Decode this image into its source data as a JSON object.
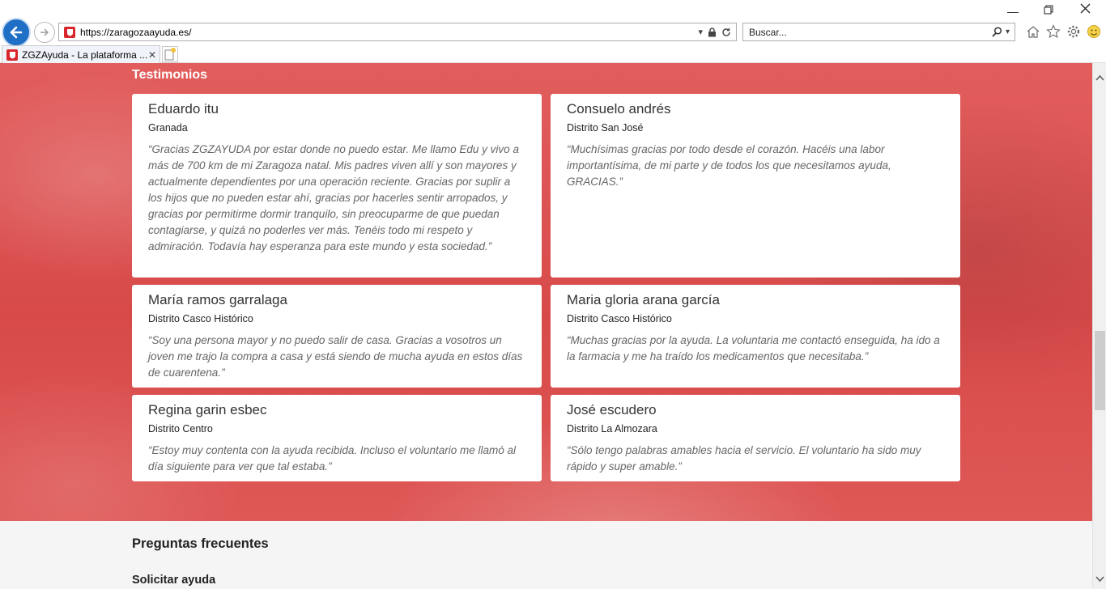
{
  "browser": {
    "url": "https://zaragozaayuda.es/",
    "search_placeholder": "Buscar...",
    "tab_title": "ZGZAyuda - La plataforma ...",
    "tab_close": "✕"
  },
  "testimonials": {
    "title": "Testimonios",
    "items": [
      {
        "name": "Eduardo itu",
        "place": "Granada",
        "quote": "“Gracias ZGZAYUDA por estar donde no puedo estar. Me llamo Edu y vivo a más de 700 km de mi Zaragoza natal. Mis padres viven allí y son mayores y actualmente dependientes por una operación reciente. Gracias por suplir a los hijos que no pueden estar ahí, gracias por hacerles sentir arropados, y gracias por permitirme dormir tranquilo, sin preocuparme de que puedan contagiarse, y quizá no poderles ver más. Tenéis todo mi respeto y admiración. Todavía hay esperanza para este mundo y esta sociedad.”"
      },
      {
        "name": "Consuelo andrés",
        "place": "Distrito San José",
        "quote": "“Muchísimas gracias por todo desde el corazón. Hacéis una labor importantísima, de mi parte y de todos los que necesitamos ayuda, GRACIAS.”"
      },
      {
        "name": "María ramos garralaga",
        "place": "Distrito Casco Histórico",
        "quote": "“Soy una persona mayor y no puedo salir de casa. Gracias a vosotros un joven me trajo la compra a casa y está siendo de mucha ayuda en estos días de cuarentena.”"
      },
      {
        "name": "Maria gloria arana garcía",
        "place": "Distrito Casco Histórico",
        "quote": "“Muchas gracias por la ayuda. La voluntaria me contactó enseguida, ha ido a la farmacia y me ha traído los medicamentos que necesitaba.”"
      },
      {
        "name": "Regina garin esbec",
        "place": "Distrito Centro",
        "quote": "“Estoy muy contenta con la ayuda recibida. Incluso el voluntario me llamó al día siguiente para ver que tal estaba.”"
      },
      {
        "name": "José escudero",
        "place": "Distrito La Almozara",
        "quote": "“Sólo tengo palabras amables hacia el servicio. El voluntario ha sido muy rápido y super amable.”"
      }
    ]
  },
  "faq": {
    "title": "Preguntas frecuentes",
    "subtitle": "Solicitar ayuda"
  },
  "colors": {
    "hero": "#d94b4b",
    "back_button": "#1f6fc6"
  }
}
